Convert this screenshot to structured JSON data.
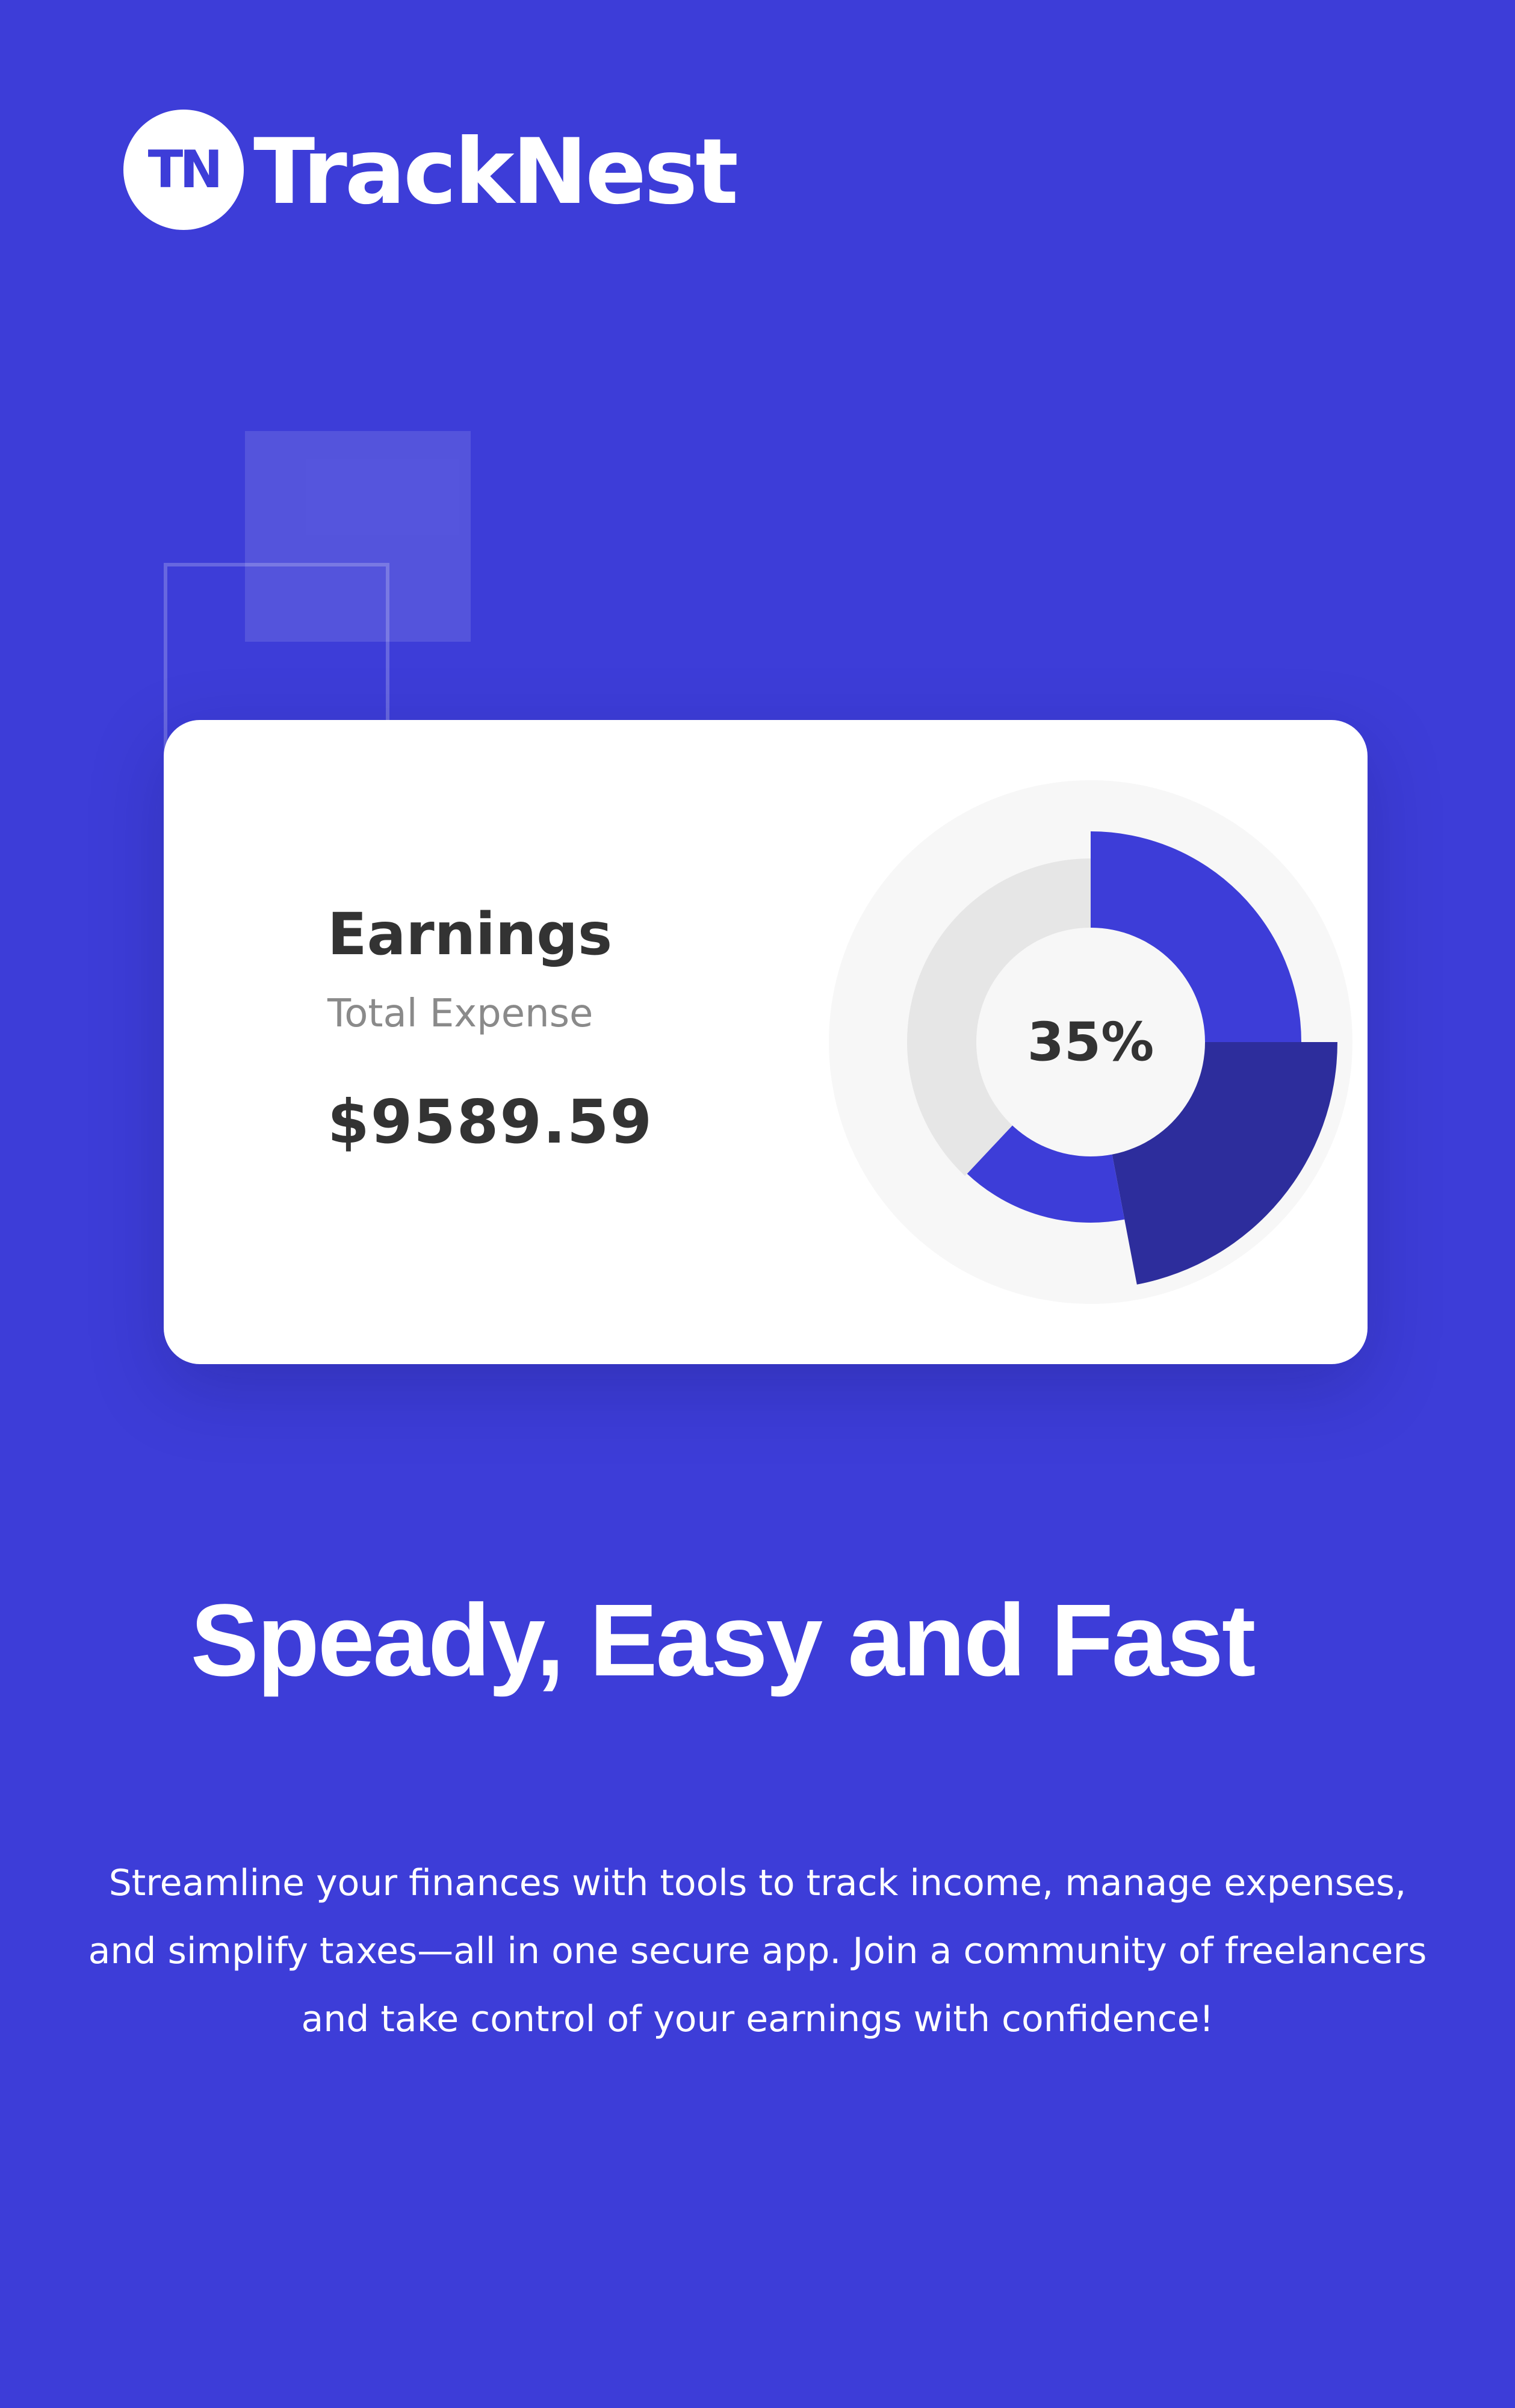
{
  "brand": {
    "logo_mark": "TN",
    "name": "TrackNest"
  },
  "card": {
    "title": "Earnings",
    "subtitle": "Total Expense",
    "amount": "$9589.59",
    "percentage_label": "35%"
  },
  "chart_data": {
    "type": "pie",
    "center_label": "35%",
    "segments": [
      {
        "value": 25,
        "color": "#3d3dd8"
      },
      {
        "value": 22,
        "color": "#2d2d9c"
      },
      {
        "value": 15,
        "color": "#3d3dd8"
      },
      {
        "value": 38,
        "color": "#e6e6e6"
      }
    ]
  },
  "headline": "Speady, Easy and Fast",
  "description": "Streamline your finances with tools to track income, manage expenses, and simplify taxes—all in one secure app. Join a community of freelancers and take control of your earnings with confidence!",
  "colors": {
    "background": "#3d3dd8",
    "accent_dark": "#2d2d9c",
    "card": "#ffffff",
    "text_dark": "#333333",
    "text_muted": "#8a8a8a"
  }
}
